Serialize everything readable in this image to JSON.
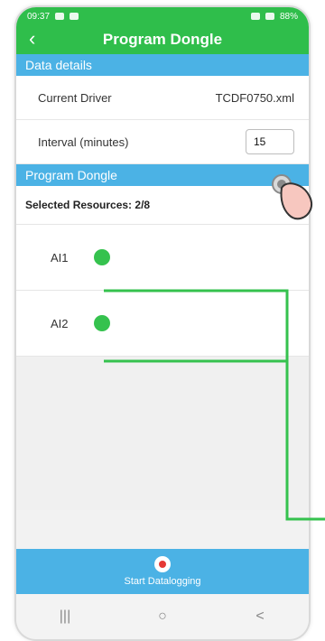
{
  "status": {
    "time": "09:37",
    "battery": "88%"
  },
  "header": {
    "title": "Program Dongle",
    "back_icon": "chevron-left-icon"
  },
  "data_details": {
    "section_title": "Data details",
    "current_driver_label": "Current Driver",
    "current_driver_value": "TCDF0750.xml",
    "interval_label": "Interval (minutes)",
    "interval_value": "15"
  },
  "program_dongle": {
    "section_title": "Program Dongle",
    "selected_resources": "Selected Resources: 2/8",
    "resources": [
      {
        "label": "AI1"
      },
      {
        "label": "AI2"
      }
    ]
  },
  "bottom_action": {
    "label": "Start Datalogging"
  },
  "nav": {
    "recent": "|||",
    "home": "○",
    "back": "<"
  }
}
